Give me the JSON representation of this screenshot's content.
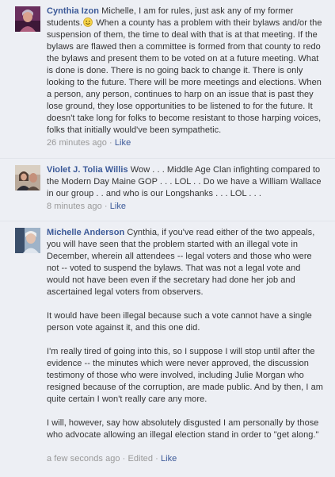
{
  "colors": {
    "background": "#edeff4",
    "author_link": "#3b5998",
    "body_text": "#333333",
    "meta_text": "#999999"
  },
  "comments": [
    {
      "author": "Cynthia Izon",
      "avatar_icon": "profile-photo",
      "text_before_emoji": "Michelle, I am for rules, just ask any of my former students.",
      "emoji_icon": "smiley-emoji",
      "text_after_emoji": " When a county has a problem with their bylaws and/or the suspension of them, the time to deal with that is at that meeting. If the bylaws are flawed then a committee is formed from that county to redo the bylaws and present them to be voted on at a future meeting. What is done is done. There is no going back to change it. There is only looking to the future. There will be more meetings and elections. When a person, any person, continues to harp on an issue that is past they lose ground, they lose opportunities to be listened to for the future. It doesn't take long for folks to become resistant to those harping voices, folks that initially would've been sympathetic.",
      "timestamp": "26 minutes ago",
      "separator": " · ",
      "like_label": "Like"
    },
    {
      "author": "Violet J. Tolia Willis",
      "avatar_icon": "profile-photo",
      "text": "Wow . . . Middle Age Clan infighting compared to the Modern Day Maine GOP . . . LOL . . Do we have a William Wallace in our group . . and who is our Longshanks . . . LOL . . .",
      "timestamp": "8 minutes ago",
      "separator": " · ",
      "like_label": "Like"
    },
    {
      "author": "Michelle Anderson",
      "avatar_icon": "profile-photo",
      "paragraphs": [
        "Cynthia, if you've read either of the two appeals, you will have seen that the problem started with an illegal vote in December, wherein all attendees -- legal voters and those who were not -- voted to suspend the bylaws. That was not a legal vote and would not have been even if the secretary had done her job and ascertained legal voters from observers.",
        "It would have been illegal because such a vote cannot have a single person vote against it, and this one did.",
        "I'm really tired of going into this, so I suppose I will stop until after the evidence -- the minutes which were never approved, the discussion testimony of those who were involved, including Julie Morgan who resigned because of the corruption, are made public. And by then, I am quite certain I won't really care any more.",
        "I will, however, say how absolutely disgusted I am personally by those who advocate allowing an illegal election stand in order to \"get along.\""
      ],
      "timestamp": "a few seconds ago",
      "separator": " · ",
      "edited_label": "Edited",
      "like_label": "Like"
    }
  ]
}
